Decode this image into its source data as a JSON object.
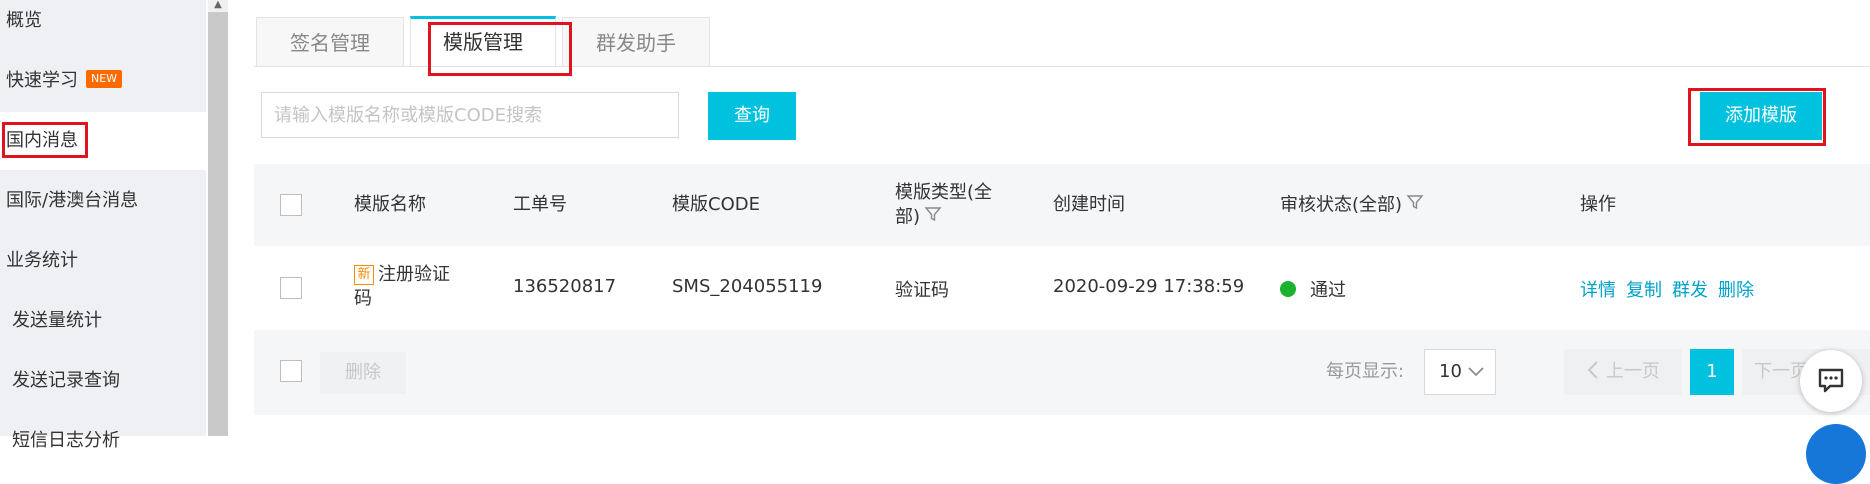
{
  "sidebar": {
    "items": [
      {
        "label": "概览"
      },
      {
        "label": "快速学习",
        "badge": "NEW"
      },
      {
        "label": "国内消息"
      },
      {
        "label": "国际/港澳台消息"
      },
      {
        "label": "业务统计"
      },
      {
        "label": "发送量统计"
      },
      {
        "label": "发送记录查询"
      },
      {
        "label": "短信日志分析"
      }
    ]
  },
  "tabs": [
    {
      "label": "签名管理"
    },
    {
      "label": "模版管理"
    },
    {
      "label": "群发助手"
    }
  ],
  "search": {
    "placeholder": "请输入模版名称或模版CODE搜索",
    "query_label": "查询",
    "add_label": "添加模版"
  },
  "table": {
    "headers": {
      "name": "模版名称",
      "ticket": "工单号",
      "code": "模版CODE",
      "type_line1": "模版类型(全",
      "type_line2": "部)",
      "created": "创建时间",
      "status": "审核状态(全部)",
      "actions": "操作"
    },
    "rows": [
      {
        "new_tag": "新",
        "name_line1": "注册验证",
        "name_line2": "码",
        "ticket": "136520817",
        "code": "SMS_204055119",
        "type": "验证码",
        "created": "2020-09-29 17:38:59",
        "status": "通过",
        "actions": [
          "详情",
          "复制",
          "群发",
          "删除"
        ]
      }
    ]
  },
  "footer": {
    "delete_label": "删除",
    "page_size_label": "每页显示:",
    "page_size": "10",
    "prev_label": "上一页",
    "current_page": "1",
    "next_label": "下一页"
  },
  "colors": {
    "accent": "#00c1de",
    "highlight": "#e0141e",
    "badge": "#ff6a00",
    "status_ok": "#1ab22e",
    "link": "#00a2ca"
  }
}
